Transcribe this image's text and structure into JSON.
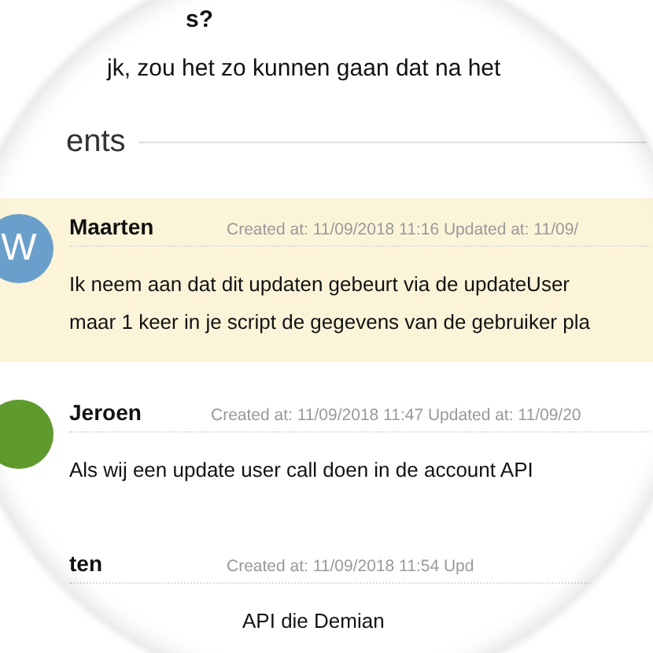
{
  "intro": {
    "heading": "s?",
    "text": "jk, zou het zo kunnen gaan dat na het"
  },
  "comments_heading": "ents",
  "comments": [
    {
      "author": "Maarten",
      "avatar": "W",
      "color": "#6b9fcb",
      "highlighted": true,
      "meta": "Created at: 11/09/2018 11:16 Updated at: 11/09/",
      "lines": [
        "Ik neem aan dat dit updaten gebeurt via de updateUser",
        "maar 1 keer in je script de gegevens van de gebruiker pla"
      ]
    },
    {
      "author": "Jeroen",
      "color": "#5f9a2c",
      "highlighted": false,
      "meta": "Created at: 11/09/2018 11:47 Updated at: 11/09/20",
      "lines": [
        "Als wij een update user call doen in de account API"
      ]
    },
    {
      "author": "ten",
      "highlighted": false,
      "meta": "Created at: 11/09/2018 11:54 Upd",
      "lines": [
        "API die Demian"
      ]
    }
  ]
}
